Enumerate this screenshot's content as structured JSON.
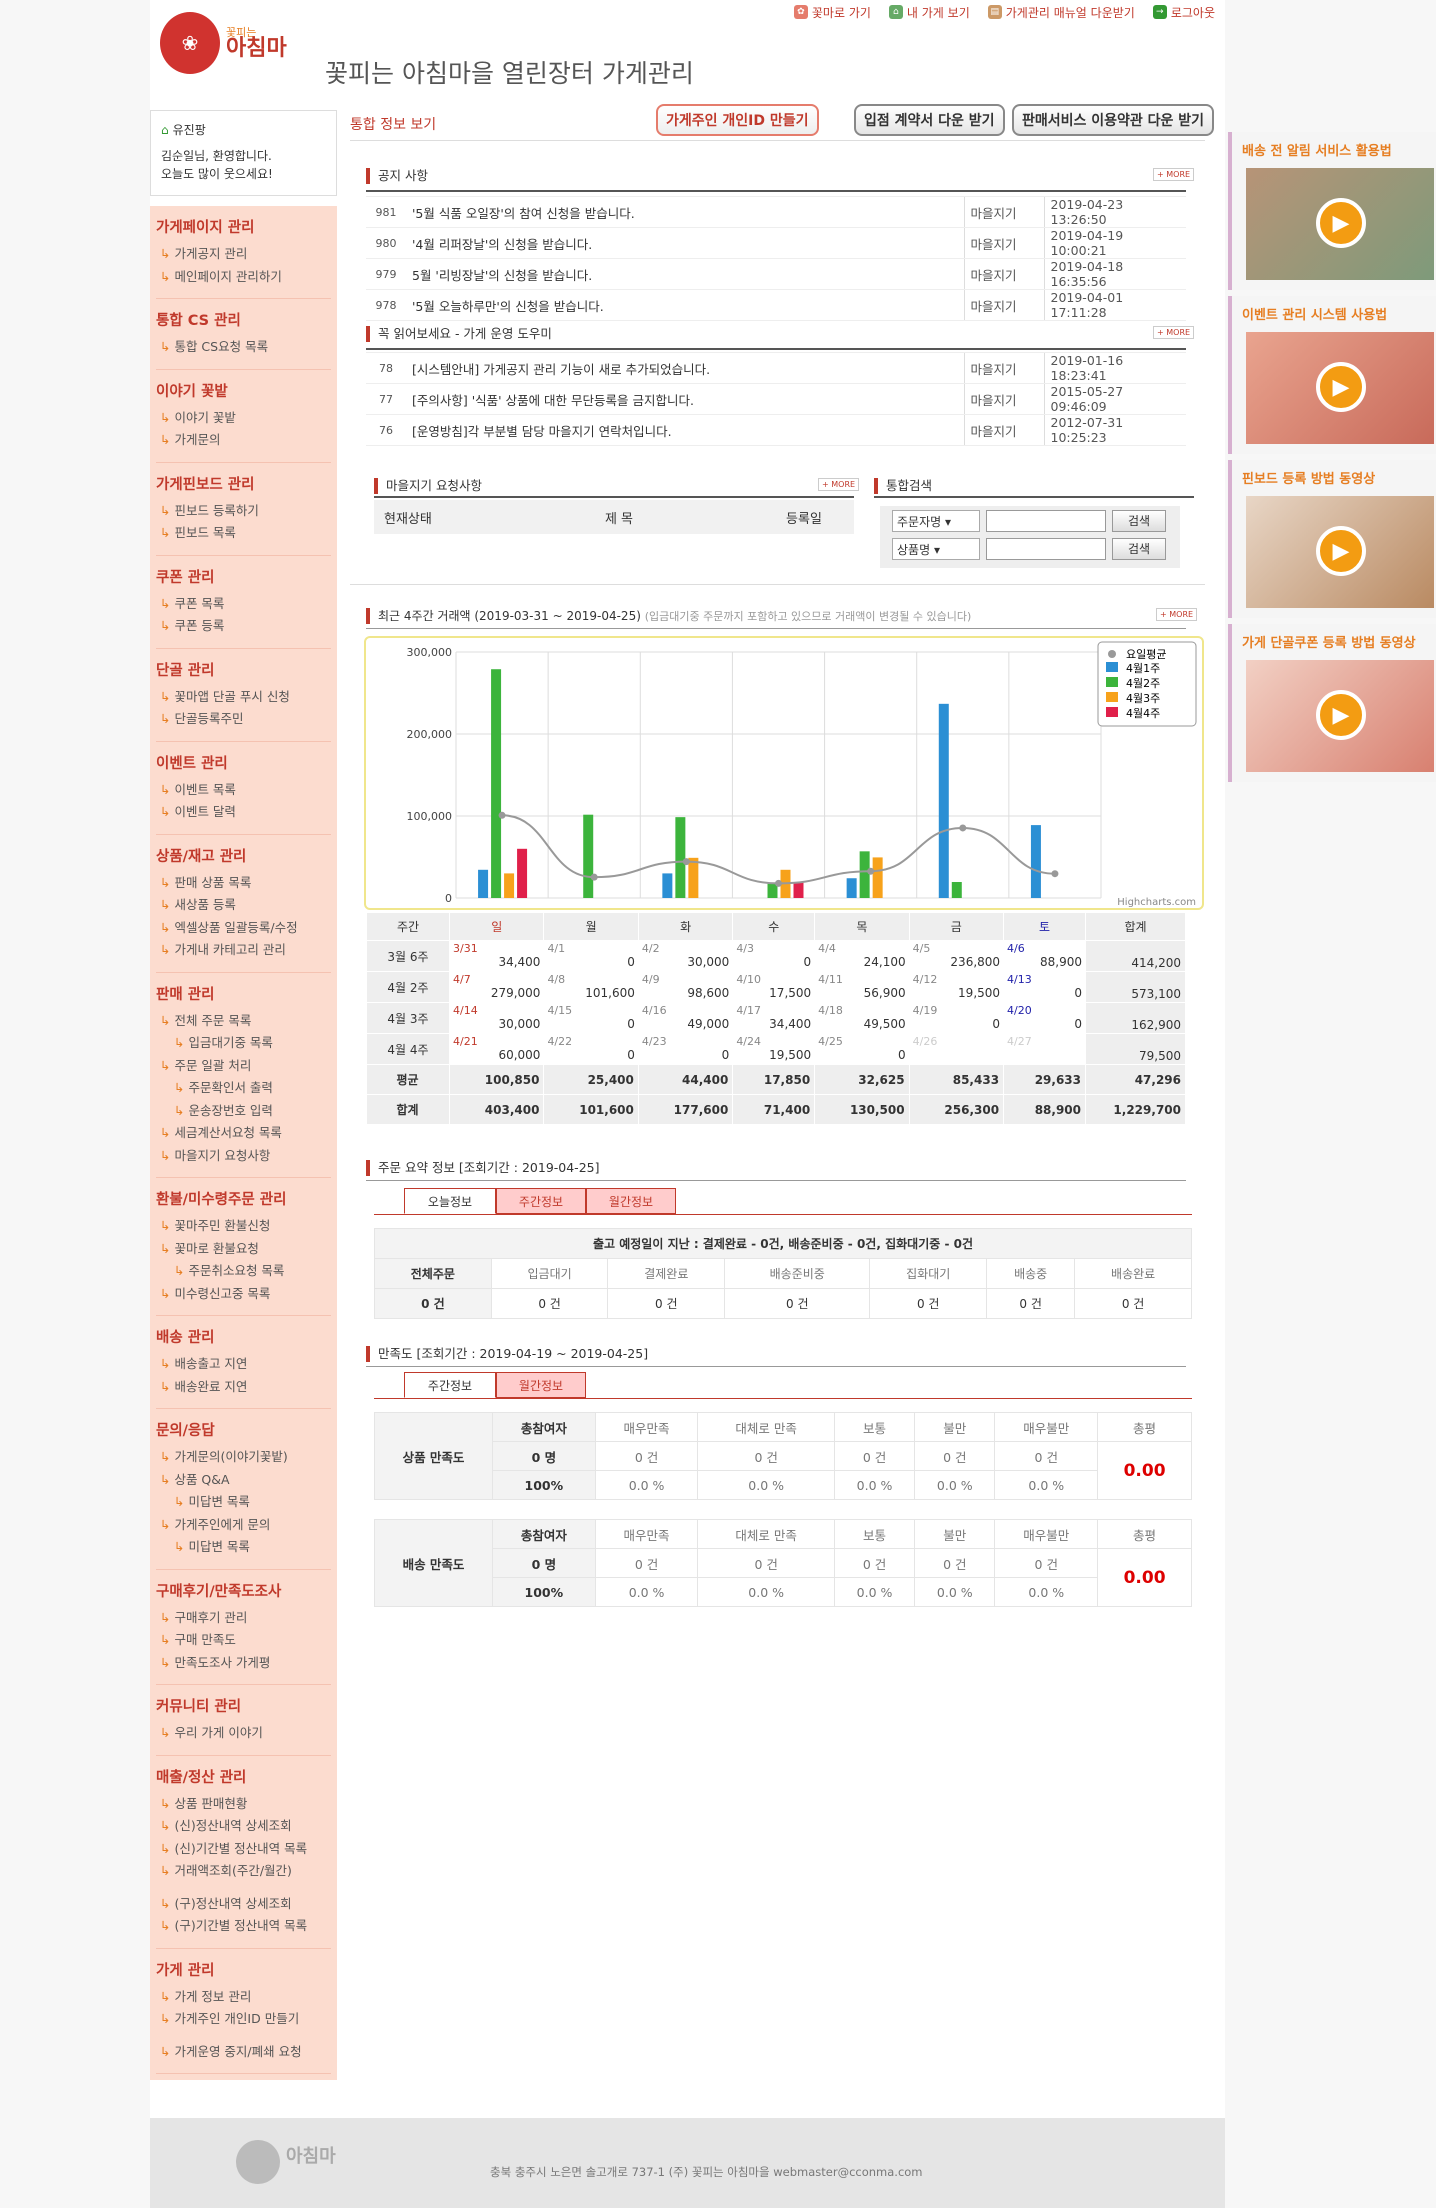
{
  "toplinks": [
    "꽃마로 가기",
    "내 가게 보기",
    "가게관리 매뉴얼 다운받기",
    "로그아웃"
  ],
  "logo": {
    "small": "꽃피는",
    "big": "아침마"
  },
  "header_title": "꽃피는 아침마을 열린장터 가게관리",
  "user": {
    "name": "유진팡",
    "greet1": "김순일님, 환영합니다.",
    "greet2": "오늘도 많이 웃으세요!"
  },
  "menu": [
    {
      "title": "가게페이지 관리",
      "items": [
        "가게공지 관리",
        "메인페이지 관리하기"
      ]
    },
    {
      "title": "통합 CS 관리",
      "items": [
        "통합 CS요청 목록"
      ]
    },
    {
      "title": "이야기 꽃밭",
      "items": [
        "이야기 꽃밭",
        "가게문의"
      ]
    },
    {
      "title": "가게핀보드 관리",
      "items": [
        "핀보드 등록하기",
        "핀보드 목록"
      ]
    },
    {
      "title": "쿠폰 관리",
      "items": [
        "쿠폰 목록",
        "쿠폰 등록"
      ]
    },
    {
      "title": "단골 관리",
      "items": [
        "꽃마앱 단골 푸시 신청",
        "단골등록주민"
      ]
    },
    {
      "title": "이벤트 관리",
      "items": [
        "이벤트 목록",
        "이벤트 달력"
      ]
    },
    {
      "title": "상품/재고 관리",
      "items": [
        "판매 상품 목록",
        "새상품 등록",
        "엑셀상품 일괄등록/수정",
        "가게내 카테고리 관리"
      ]
    },
    {
      "title": "판매 관리",
      "items": [
        "전체 주문 목록",
        "입금대기중 목록",
        "주문 일괄 처리",
        "주문확인서 출력",
        "운송장번호 입력",
        "세금계산서요청 목록",
        "마을지기 요청사항"
      ]
    },
    {
      "title": "환불/미수령주문 관리",
      "items": [
        "꽃마주민 환불신청",
        "꽃마로 환불요청",
        "주문취소요청 목록",
        "미수령신고중 목록"
      ]
    },
    {
      "title": "배송 관리",
      "items": [
        "배송출고 지연",
        "배송완료 지연"
      ]
    },
    {
      "title": "문의/응답",
      "items": [
        "가게문의(이야기꽃밭)",
        "상품 Q&A",
        "미답변 목록",
        "가게주인에게 문의",
        "미답변 목록"
      ]
    },
    {
      "title": "구매후기/만족도조사",
      "items": [
        "구매후기 관리",
        "구매 만족도",
        "만족도조사 가게평"
      ]
    },
    {
      "title": "커뮤니티 관리",
      "items": [
        "우리 가게 이야기"
      ]
    },
    {
      "title": "매출/정산 관리",
      "items": [
        "상품 판매현황",
        "(신)정산내역 상세조회",
        "(신)기간별 정산내역 목록",
        "거래액조회(주간/월간)",
        "(구)정산내역 상세조회",
        "(구)기간별 정산내역 목록"
      ]
    },
    {
      "title": "가게 관리",
      "items": [
        "가게 정보 관리",
        "가게주인 개인ID 만들기",
        "가게운영 중지/폐쇄 요청"
      ]
    }
  ],
  "breadcrumb": "통합 정보 보기",
  "buttons": {
    "owner_id": "가게주인 개인ID 만들기",
    "contract": "입점 계약서 다운 받기",
    "terms": "판매서비스 이용약관 다운 받기"
  },
  "more_label": "MORE",
  "notice": {
    "title": "공지 사항",
    "rows": [
      {
        "no": "981",
        "title": "'5월 식품 오일장'의 참여 신청을 받습니다.",
        "writer": "마을지기",
        "date": "2019-04-23 13:26:50"
      },
      {
        "no": "980",
        "title": "'4월 리퍼장날'의 신청을 받습니다.",
        "writer": "마을지기",
        "date": "2019-04-19 10:00:21"
      },
      {
        "no": "979",
        "title": "5월 '리빙장날'의 신청을 받습니다.",
        "writer": "마을지기",
        "date": "2019-04-18 16:35:56"
      },
      {
        "no": "978",
        "title": "'5월 오늘하루만'의 신청을 받습니다.",
        "writer": "마을지기",
        "date": "2019-04-01 17:11:28"
      }
    ]
  },
  "guide": {
    "title": "꼭 읽어보세요 - 가게 운영 도우미",
    "rows": [
      {
        "no": "78",
        "title": "[시스템안내] 가게공지 관리 기능이 새로 추가되었습니다.",
        "writer": "마을지기",
        "date": "2019-01-16 18:23:41"
      },
      {
        "no": "77",
        "title": "[주의사항] '식품' 상품에 대한 무단등록을 금지합니다.",
        "writer": "마을지기",
        "date": "2015-05-27 09:46:09"
      },
      {
        "no": "76",
        "title": "[운영방침]각 부분별 담당 마을지기 연락처입니다.",
        "writer": "마을지기",
        "date": "2012-07-31 10:25:23"
      }
    ]
  },
  "requests": {
    "title": "마을지기 요청사항",
    "cols": [
      "현재상태",
      "제 목",
      "등록일"
    ]
  },
  "search": {
    "title": "통합검색",
    "opt1": "주문자명",
    "opt2": "상품명",
    "btn": "검색"
  },
  "trade": {
    "title": "최근 4주간 거래액 (2019-03-31 ~ 2019-04-25)",
    "note": "(입금대기중 주문까지 포함하고 있으므로 거래액이 변경될 수 있습니다)"
  },
  "chart_data": {
    "type": "bar",
    "categories": [
      "일",
      "월",
      "화",
      "수",
      "목",
      "금",
      "토"
    ],
    "series": [
      {
        "name": "4월1주",
        "color": "#2b8fd4",
        "values": [
          34400,
          0,
          30000,
          0,
          24100,
          236800,
          88900
        ]
      },
      {
        "name": "4월2주",
        "color": "#3cb43c",
        "values": [
          279000,
          101600,
          98600,
          17500,
          56900,
          19500,
          0
        ]
      },
      {
        "name": "4월3주",
        "color": "#f7a21b",
        "values": [
          30000,
          0,
          49000,
          34400,
          49500,
          0,
          0
        ]
      },
      {
        "name": "4월4주",
        "color": "#e0204a",
        "values": [
          60000,
          0,
          0,
          19500,
          0,
          0,
          0
        ]
      }
    ],
    "line": {
      "name": "요일평균",
      "color": "#999",
      "values": [
        100850,
        25400,
        44400,
        17850,
        32625,
        85433,
        29633
      ]
    },
    "yticks": [
      "300,000",
      "200,000",
      "100,000",
      "0"
    ],
    "ylim": [
      0,
      300000
    ],
    "credit": "Highcharts.com",
    "legend": "top-right"
  },
  "cal": {
    "head": [
      "주간",
      "일",
      "월",
      "화",
      "수",
      "목",
      "금",
      "토",
      "합계"
    ],
    "rows": [
      {
        "label": "3월 6주",
        "days": [
          [
            "3/31",
            "34,400"
          ],
          [
            "4/1",
            "0"
          ],
          [
            "4/2",
            "30,000"
          ],
          [
            "4/3",
            "0"
          ],
          [
            "4/4",
            "24,100"
          ],
          [
            "4/5",
            "236,800"
          ],
          [
            "4/6",
            "88,900"
          ]
        ],
        "total": "414,200"
      },
      {
        "label": "4월 2주",
        "days": [
          [
            "4/7",
            "279,000"
          ],
          [
            "4/8",
            "101,600"
          ],
          [
            "4/9",
            "98,600"
          ],
          [
            "4/10",
            "17,500"
          ],
          [
            "4/11",
            "56,900"
          ],
          [
            "4/12",
            "19,500"
          ],
          [
            "4/13",
            "0"
          ]
        ],
        "total": "573,100"
      },
      {
        "label": "4월 3주",
        "days": [
          [
            "4/14",
            "30,000"
          ],
          [
            "4/15",
            "0"
          ],
          [
            "4/16",
            "49,000"
          ],
          [
            "4/17",
            "34,400"
          ],
          [
            "4/18",
            "49,500"
          ],
          [
            "4/19",
            "0"
          ],
          [
            "4/20",
            "0"
          ]
        ],
        "total": "162,900"
      },
      {
        "label": "4월 4주",
        "days": [
          [
            "4/21",
            "60,000"
          ],
          [
            "4/22",
            "0"
          ],
          [
            "4/23",
            "0"
          ],
          [
            "4/24",
            "19,500"
          ],
          [
            "4/25",
            "0"
          ],
          [
            "4/26",
            ""
          ],
          [
            "4/27",
            ""
          ]
        ],
        "total": "79,500"
      }
    ],
    "avg": {
      "label": "평균",
      "vals": [
        "100,850",
        "25,400",
        "44,400",
        "17,850",
        "32,625",
        "85,433",
        "29,633",
        "47,296"
      ]
    },
    "sum": {
      "label": "합계",
      "vals": [
        "403,400",
        "101,600",
        "177,600",
        "71,400",
        "130,500",
        "256,300",
        "88,900",
        "1,229,700"
      ]
    }
  },
  "order": {
    "title": "주문 요약 정보 [조회기간 : 2019-04-25]",
    "tabs": [
      "오늘정보",
      "주간정보",
      "월간정보"
    ],
    "banner": "출고 예정일이 지난 : 결제완료 - 0건, 배송준비중 - 0건, 집화대기중 - 0건",
    "cols": [
      "전체주문",
      "입금대기",
      "결제완료",
      "배송준비중",
      "집화대기",
      "배송중",
      "배송완료"
    ],
    "vals": [
      "0 건",
      "0 건",
      "0 건",
      "0 건",
      "0 건",
      "0 건",
      "0 건"
    ]
  },
  "satis": {
    "title": "만족도 [조회기간 : 2019-04-19 ~ 2019-04-25]",
    "tabs": [
      "주간정보",
      "월간정보"
    ],
    "cols": [
      "총참여자",
      "매우만족",
      "대체로 만족",
      "보통",
      "불만",
      "매우불만",
      "총평"
    ],
    "blocks": [
      {
        "label": "상품 만족도",
        "counts": [
          "0 명",
          "0 건",
          "0 건",
          "0 건",
          "0 건",
          "0 건"
        ],
        "pcts": [
          "100%",
          "0.0 %",
          "0.0 %",
          "0.0 %",
          "0.0 %",
          "0.0 %"
        ],
        "score": "0.00"
      },
      {
        "label": "배송 만족도",
        "counts": [
          "0 명",
          "0 건",
          "0 건",
          "0 건",
          "0 건",
          "0 건"
        ],
        "pcts": [
          "100%",
          "0.0 %",
          "0.0 %",
          "0.0 %",
          "0.0 %",
          "0.0 %"
        ],
        "score": "0.00"
      }
    ]
  },
  "ads": [
    "배송 전 알림 서비스 활용법",
    "이벤트 관리 시스템 사용법",
    "핀보드 등록 방법 동영상",
    "가게 단골쿠폰 등록 방법 동영상"
  ],
  "footer": "충북 충주시 노은면 솔고개로 737-1 (주) 꽃피는 아침마을 webmaster@cconma.com"
}
